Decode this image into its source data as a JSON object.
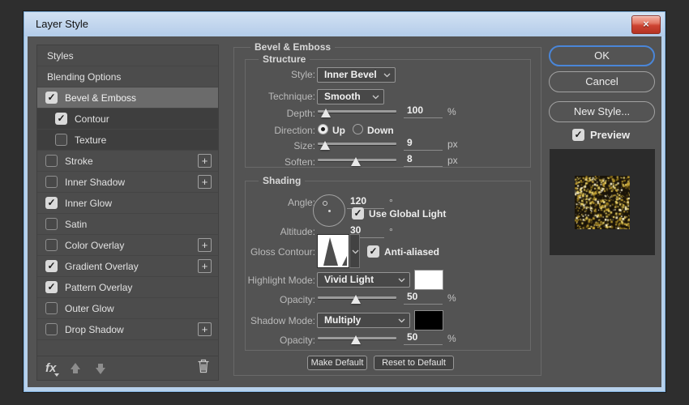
{
  "window": {
    "title": "Layer Style"
  },
  "sidebar": {
    "items": [
      {
        "label": "Styles",
        "checkbox": false,
        "checked": false,
        "sub": false,
        "selected": false,
        "plus": false
      },
      {
        "label": "Blending Options",
        "checkbox": false,
        "checked": false,
        "sub": false,
        "selected": false,
        "plus": false
      },
      {
        "label": "Bevel & Emboss",
        "checkbox": true,
        "checked": true,
        "sub": false,
        "selected": true,
        "plus": false
      },
      {
        "label": "Contour",
        "checkbox": true,
        "checked": true,
        "sub": true,
        "selected": false,
        "plus": false
      },
      {
        "label": "Texture",
        "checkbox": true,
        "checked": false,
        "sub": true,
        "selected": false,
        "plus": false
      },
      {
        "label": "Stroke",
        "checkbox": true,
        "checked": false,
        "sub": false,
        "selected": false,
        "plus": true
      },
      {
        "label": "Inner Shadow",
        "checkbox": true,
        "checked": false,
        "sub": false,
        "selected": false,
        "plus": true
      },
      {
        "label": "Inner Glow",
        "checkbox": true,
        "checked": true,
        "sub": false,
        "selected": false,
        "plus": false
      },
      {
        "label": "Satin",
        "checkbox": true,
        "checked": false,
        "sub": false,
        "selected": false,
        "plus": false
      },
      {
        "label": "Color Overlay",
        "checkbox": true,
        "checked": false,
        "sub": false,
        "selected": false,
        "plus": true
      },
      {
        "label": "Gradient Overlay",
        "checkbox": true,
        "checked": true,
        "sub": false,
        "selected": false,
        "plus": true
      },
      {
        "label": "Pattern Overlay",
        "checkbox": true,
        "checked": true,
        "sub": false,
        "selected": false,
        "plus": false
      },
      {
        "label": "Outer Glow",
        "checkbox": true,
        "checked": false,
        "sub": false,
        "selected": false,
        "plus": false
      },
      {
        "label": "Drop Shadow",
        "checkbox": true,
        "checked": false,
        "sub": false,
        "selected": false,
        "plus": true
      }
    ],
    "fx_label": "fx"
  },
  "panel": {
    "title": "Bevel & Emboss",
    "structure": {
      "title": "Structure",
      "style": {
        "label": "Style:",
        "value": "Inner Bevel"
      },
      "technique": {
        "label": "Technique:",
        "value": "Smooth"
      },
      "depth": {
        "label": "Depth:",
        "value": "100",
        "unit": "%",
        "pct": 10
      },
      "direction": {
        "label": "Direction:",
        "up": "Up",
        "down": "Down",
        "up_selected": true,
        "down_selected": false
      },
      "size": {
        "label": "Size:",
        "value": "9",
        "unit": "px",
        "pct": 9
      },
      "soften": {
        "label": "Soften:",
        "value": "8",
        "unit": "px",
        "pct": 48
      }
    },
    "shading": {
      "title": "Shading",
      "angle": {
        "label": "Angle:",
        "value": "120",
        "unit": "°"
      },
      "use_global_light": {
        "label": "Use Global Light",
        "checked": true
      },
      "altitude": {
        "label": "Altitude:",
        "value": "30",
        "unit": "°"
      },
      "gloss_contour": {
        "label": "Gloss Contour:"
      },
      "anti_aliased": {
        "label": "Anti-aliased",
        "checked": true
      },
      "highlight_mode": {
        "label": "Highlight Mode:",
        "value": "Vivid Light",
        "swatch": "#ffffff"
      },
      "highlight_opacity": {
        "label": "Opacity:",
        "value": "50",
        "unit": "%",
        "pct": 48
      },
      "shadow_mode": {
        "label": "Shadow Mode:",
        "value": "Multiply",
        "swatch": "#000000"
      },
      "shadow_opacity": {
        "label": "Opacity:",
        "value": "50",
        "unit": "%",
        "pct": 48
      }
    },
    "footer": {
      "make_default": "Make Default",
      "reset_to_default": "Reset to Default"
    }
  },
  "actions": {
    "ok": "OK",
    "cancel": "Cancel",
    "new_style": "New Style...",
    "preview": {
      "label": "Preview",
      "checked": true
    }
  },
  "preview_texture": {
    "background": "#191308",
    "palette": [
      "#fff6cf",
      "#ecd468",
      "#c3a133",
      "#8a701c",
      "#4a3a10"
    ]
  }
}
